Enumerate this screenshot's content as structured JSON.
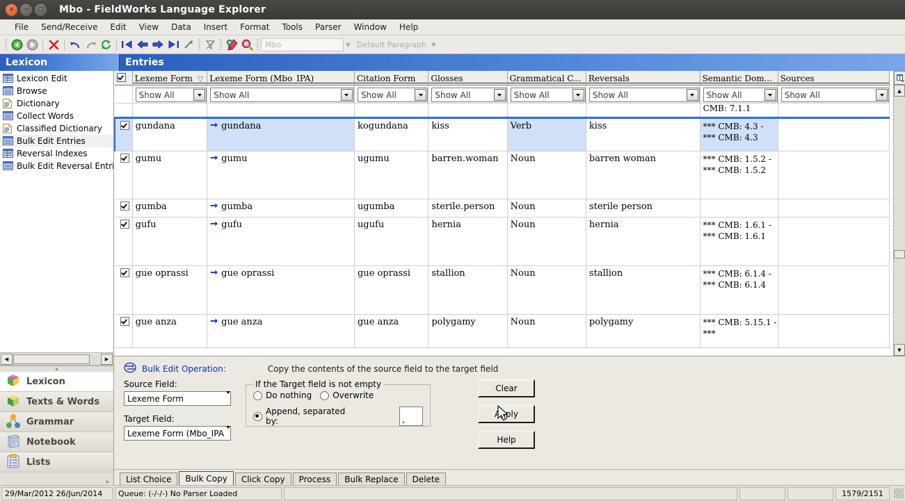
{
  "window": {
    "title": "Mbo - FieldWorks Language Explorer",
    "buttons": {
      "close": "×",
      "minimize": "−",
      "maximize": "□"
    }
  },
  "menubar": {
    "items": [
      "File",
      "Send/Receive",
      "Edit",
      "View",
      "Data",
      "Insert",
      "Format",
      "Tools",
      "Parser",
      "Window",
      "Help"
    ]
  },
  "toolbar": {
    "icons": [
      "back-icon",
      "forward-icon",
      "delete-icon",
      "undo-icon",
      "redo-icon",
      "refresh-icon",
      "first-icon",
      "previous-icon",
      "next-icon",
      "last-icon",
      "jump-icon",
      "filter-icon",
      "insert-entry-icon",
      "find-icon"
    ],
    "writing_system": "Mbo",
    "paragraph_style": "Default Paragraph"
  },
  "headers": {
    "left": "Lexicon",
    "right": "Entries"
  },
  "sidebar": {
    "items": [
      {
        "label": "Lexicon Edit",
        "icon": "grid-view-icon",
        "selected": false
      },
      {
        "label": "Browse",
        "icon": "browse-view-icon",
        "selected": false
      },
      {
        "label": "Dictionary",
        "icon": "document-icon",
        "selected": false
      },
      {
        "label": "Collect Words",
        "icon": "browse-view-icon",
        "selected": false
      },
      {
        "label": "Classified Dictionary",
        "icon": "document-icon",
        "selected": false
      },
      {
        "label": "Bulk Edit Entries",
        "icon": "browse-view-icon",
        "selected": true
      },
      {
        "label": "Reversal Indexes",
        "icon": "grid-view-icon",
        "selected": false
      },
      {
        "label": "Bulk Edit Reversal Entrie",
        "icon": "browse-view-icon",
        "selected": false
      }
    ]
  },
  "areabar": {
    "items": [
      {
        "label": "Lexicon",
        "icon": "lexicon-cube-icon",
        "active": true
      },
      {
        "label": "Texts & Words",
        "icon": "texts-cube-icon",
        "active": false
      },
      {
        "label": "Grammar",
        "icon": "grammar-nodes-icon",
        "active": false
      },
      {
        "label": "Notebook",
        "icon": "notebook-icon",
        "active": false
      },
      {
        "label": "Lists",
        "icon": "lists-clipboard-icon",
        "active": false
      }
    ],
    "more": "»"
  },
  "grid": {
    "columns": [
      {
        "label": "Lexeme Form",
        "sorted": true,
        "sort_icon": "sort-descending-icon",
        "filter": "Show All"
      },
      {
        "label": "Lexeme Form (Mbo_IPA)",
        "sorted": false,
        "filter": "Show All"
      },
      {
        "label": "Citation Form",
        "sorted": false,
        "filter": "Show All"
      },
      {
        "label": "Glosses",
        "sorted": false,
        "filter": "Show All"
      },
      {
        "label": "Grammatical C...",
        "sorted": false,
        "filter": "Show All"
      },
      {
        "label": "Reversals",
        "sorted": false,
        "filter": "Show All"
      },
      {
        "label": "Semantic Dom...",
        "sorted": false,
        "filter": "Show All"
      },
      {
        "label": "Sources",
        "sorted": false,
        "filter": "Show All"
      }
    ],
    "select_all_checked": true,
    "partial_row_top": {
      "semantic_domain": "CMB: 7.1.1"
    },
    "rows": [
      {
        "checked": true,
        "selected": true,
        "lexeme": "gundana",
        "ipa": "gundana",
        "citation": "kogundana",
        "gloss": "kiss",
        "pos": "Verb",
        "reversal": "kiss",
        "semantic_domain": "*** CMB: 4.3 - *** CMB: 4.3",
        "source": ""
      },
      {
        "checked": true,
        "selected": false,
        "lexeme": "gumu",
        "ipa": "gumu",
        "citation": "ugumu",
        "gloss": "barren.woman",
        "pos": "Noun",
        "reversal": "barren woman",
        "semantic_domain": "*** CMB: 1.5.2 - *** CMB: 1.5.2",
        "source": ""
      },
      {
        "checked": true,
        "selected": false,
        "lexeme": "gumba",
        "ipa": "gumba",
        "citation": "ugumba",
        "gloss": "sterile.person",
        "pos": "Noun",
        "reversal": "sterile person",
        "semantic_domain": "",
        "source": ""
      },
      {
        "checked": true,
        "selected": false,
        "lexeme": "gufu",
        "ipa": "gufu",
        "citation": "ugufu",
        "gloss": "hernia",
        "pos": "Noun",
        "reversal": "hernia",
        "semantic_domain": "*** CMB: 1.6.1 - *** CMB: 1.6.1",
        "source": ""
      },
      {
        "checked": true,
        "selected": false,
        "lexeme": "gue oprassi",
        "ipa": "gue oprassi",
        "citation": "gue oprassi",
        "gloss": "stallion",
        "pos": "Noun",
        "reversal": "stallion",
        "semantic_domain": "*** CMB: 6.1.4 - *** CMB: 6.1.4",
        "source": ""
      },
      {
        "checked": true,
        "selected": false,
        "lexeme": "gue anza",
        "ipa": "gue anza",
        "citation": "gue anza",
        "gloss": "polygamy",
        "pos": "Noun",
        "reversal": "polygamy",
        "semantic_domain": "*** CMB: 5.15.1 - ***",
        "source": ""
      }
    ]
  },
  "bulkedit": {
    "icon": "bulk-edit-icon",
    "title": "Bulk Edit Operation:",
    "description": "Copy the contents of the source field to the target field",
    "source_label": "Source Field:",
    "source_value": "Lexeme Form",
    "target_label": "Target Field:",
    "target_value": "Lexeme Form (Mbo_IPA",
    "fieldset_legend": "If the Target field is not empty",
    "options": [
      {
        "label": "Do nothing",
        "selected": false
      },
      {
        "label": "Overwrite",
        "selected": false
      },
      {
        "label": "Append, separated by:",
        "selected": true
      }
    ],
    "separator_value": ",",
    "buttons": [
      "Clear",
      "Apply",
      "Help"
    ]
  },
  "tabs": {
    "items": [
      {
        "label": "List Choice",
        "active": false
      },
      {
        "label": "Bulk Copy",
        "active": true
      },
      {
        "label": "Click Copy",
        "active": false
      },
      {
        "label": "Process",
        "active": false
      },
      {
        "label": "Bulk Replace",
        "active": false
      },
      {
        "label": "Delete",
        "active": false
      }
    ]
  },
  "statusbar": {
    "dates": "29/Mar/2012 26/Jun/2014",
    "queue": "Queue: (-/-/-) No Parser Loaded",
    "progress": "",
    "field1": "",
    "field2": "",
    "record_count": "1579/2151"
  },
  "colors": {
    "header_blue_dark": "#2a5fc0",
    "header_blue_light": "#7aa6e8",
    "selection": "#cfe0f8",
    "selection_border": "#2f6fcf",
    "link": "#0033cc",
    "arrow_blue": "#0a35c8"
  }
}
